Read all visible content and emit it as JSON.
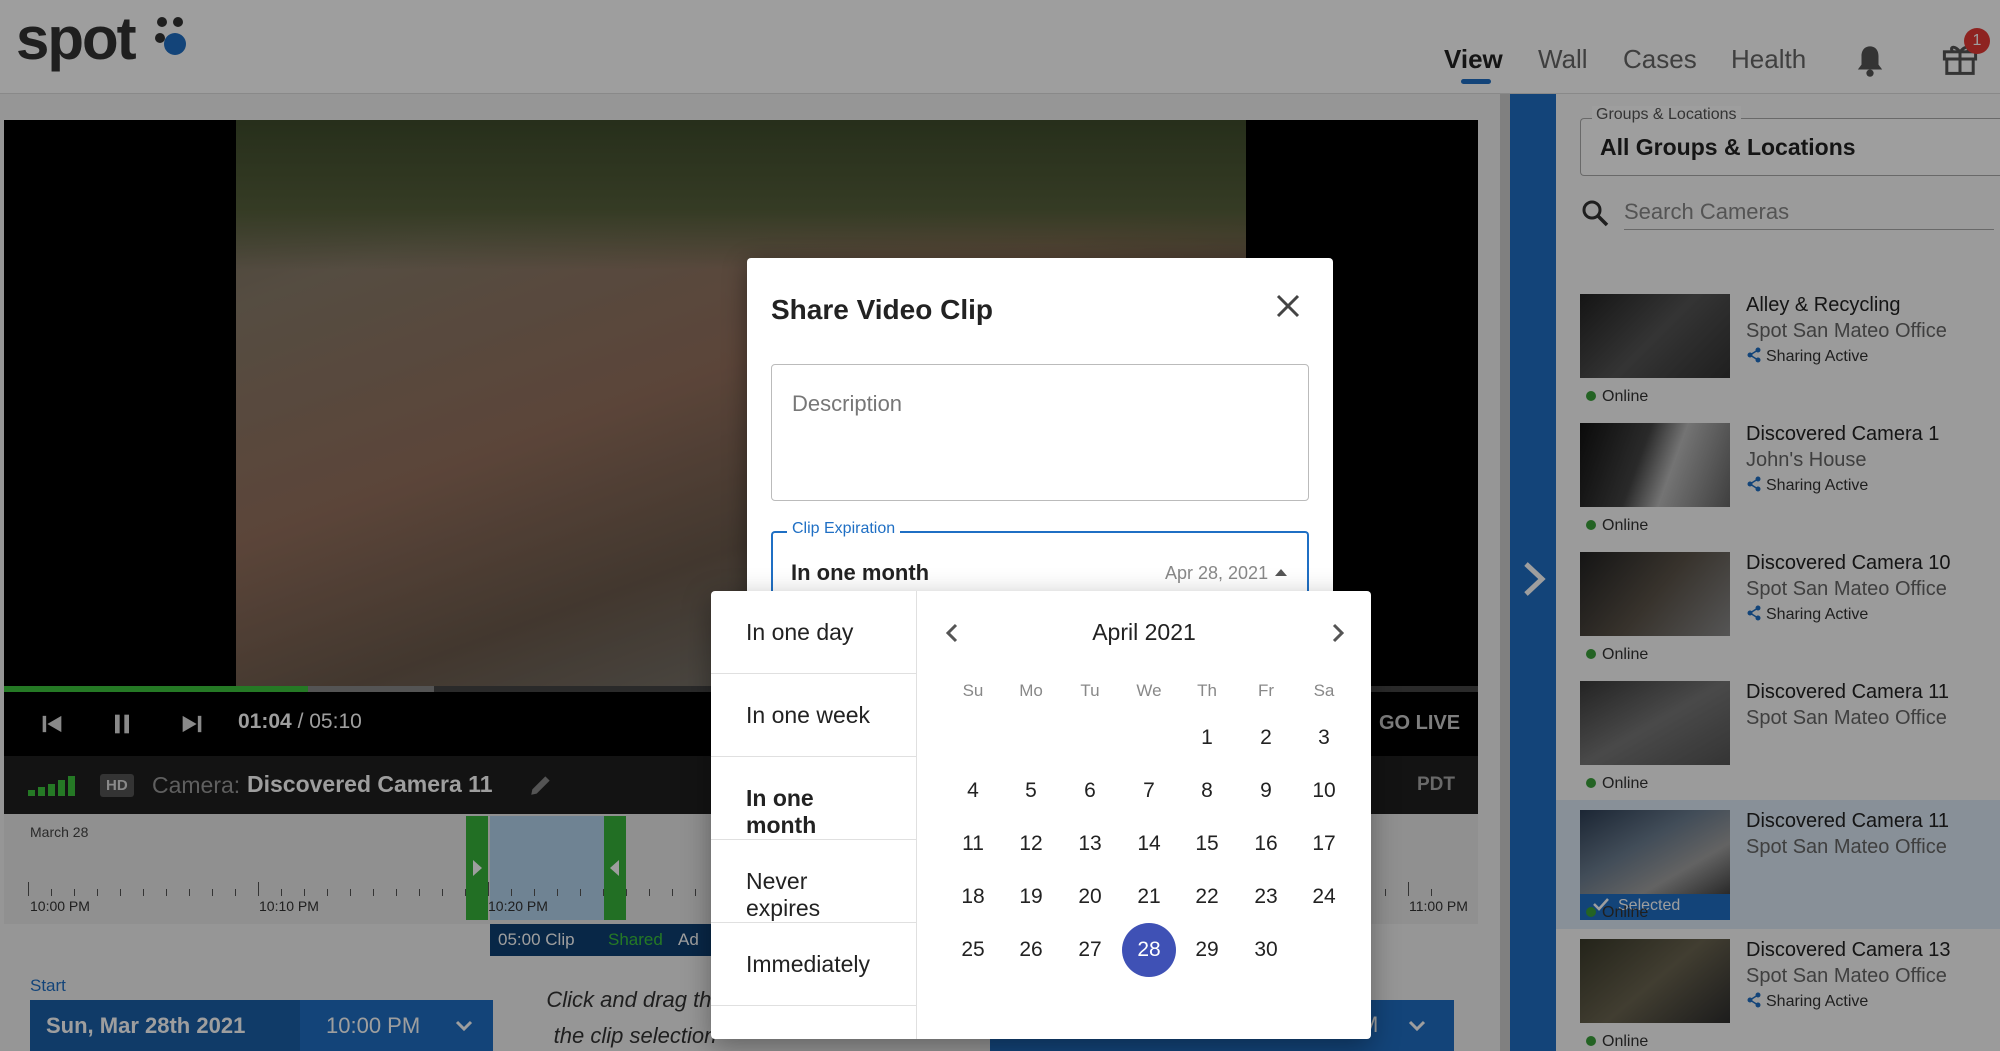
{
  "header": {
    "logo": "spot",
    "nav": [
      {
        "label": "View",
        "active": true
      },
      {
        "label": "Wall",
        "active": false
      },
      {
        "label": "Cases",
        "active": false
      },
      {
        "label": "Health",
        "active": false
      }
    ],
    "notification_badge": "1",
    "accent": "#1f6fc4"
  },
  "player": {
    "time_current": "01:04",
    "time_separator": "/",
    "time_total": "05:10",
    "go_live": "GO LIVE",
    "quality": "HD",
    "camera_label": "Camera:",
    "camera_name": "Discovered Camera 11",
    "timezone": "PDT",
    "progress_percent": 20.6
  },
  "timeline": {
    "date": "March 28",
    "labels": [
      "10:00 PM",
      "10:10 PM",
      "10:20 PM",
      "11:00 PM"
    ],
    "clip": {
      "length": "05:00 Clip",
      "status": "Shared",
      "extra": "Ad"
    }
  },
  "range": {
    "start_label": "Start",
    "start_date": "Sun, Mar 28th 2021",
    "start_time": "10:00 PM",
    "hint_line1": "Click and drag the",
    "hint_line2": "the clip selection",
    "end_time_partial": "M"
  },
  "sidebar": {
    "groups_label": "Groups & Locations",
    "groups_value": "All Groups & Locations",
    "search_placeholder": "Search Cameras",
    "cameras": [
      {
        "name": "Alley & Recycling",
        "location": "Spot San Mateo Office",
        "sharing": "Sharing Active",
        "status": "Online"
      },
      {
        "name": "Discovered Camera 1",
        "location": "John's House",
        "sharing": "Sharing Active",
        "status": "Online"
      },
      {
        "name": "Discovered Camera 10",
        "location": "Spot San Mateo Office",
        "sharing": "Sharing Active",
        "status": "Online"
      },
      {
        "name": "Discovered Camera 11",
        "location": "Spot San Mateo Office",
        "sharing": "",
        "status": "Online"
      },
      {
        "name": "Discovered Camera 11",
        "location": "Spot San Mateo Office",
        "sharing": "",
        "status": "Online",
        "selected_label": "Selected"
      },
      {
        "name": "Discovered Camera 13",
        "location": "Spot San Mateo Office",
        "sharing": "Sharing Active",
        "status": "Online"
      }
    ]
  },
  "modal": {
    "title": "Share Video Clip",
    "description_placeholder": "Description",
    "expiration_label": "Clip Expiration",
    "expiration_value": "In one month",
    "expiration_date": "Apr 28, 2021"
  },
  "expiration_options": [
    {
      "label": "In one day",
      "active": false
    },
    {
      "label": "In one week",
      "active": false
    },
    {
      "label": "In one month",
      "active": true
    },
    {
      "label": "Never expires",
      "active": false
    },
    {
      "label": "Immediately",
      "active": false
    }
  ],
  "calendar": {
    "month_label": "April 2021",
    "weekdays": [
      "Su",
      "Mo",
      "Tu",
      "We",
      "Th",
      "Fr",
      "Sa"
    ],
    "first_weekday_index": 4,
    "days_in_month": 30,
    "selected_day": 28,
    "selected_color": "#3f51b5"
  }
}
